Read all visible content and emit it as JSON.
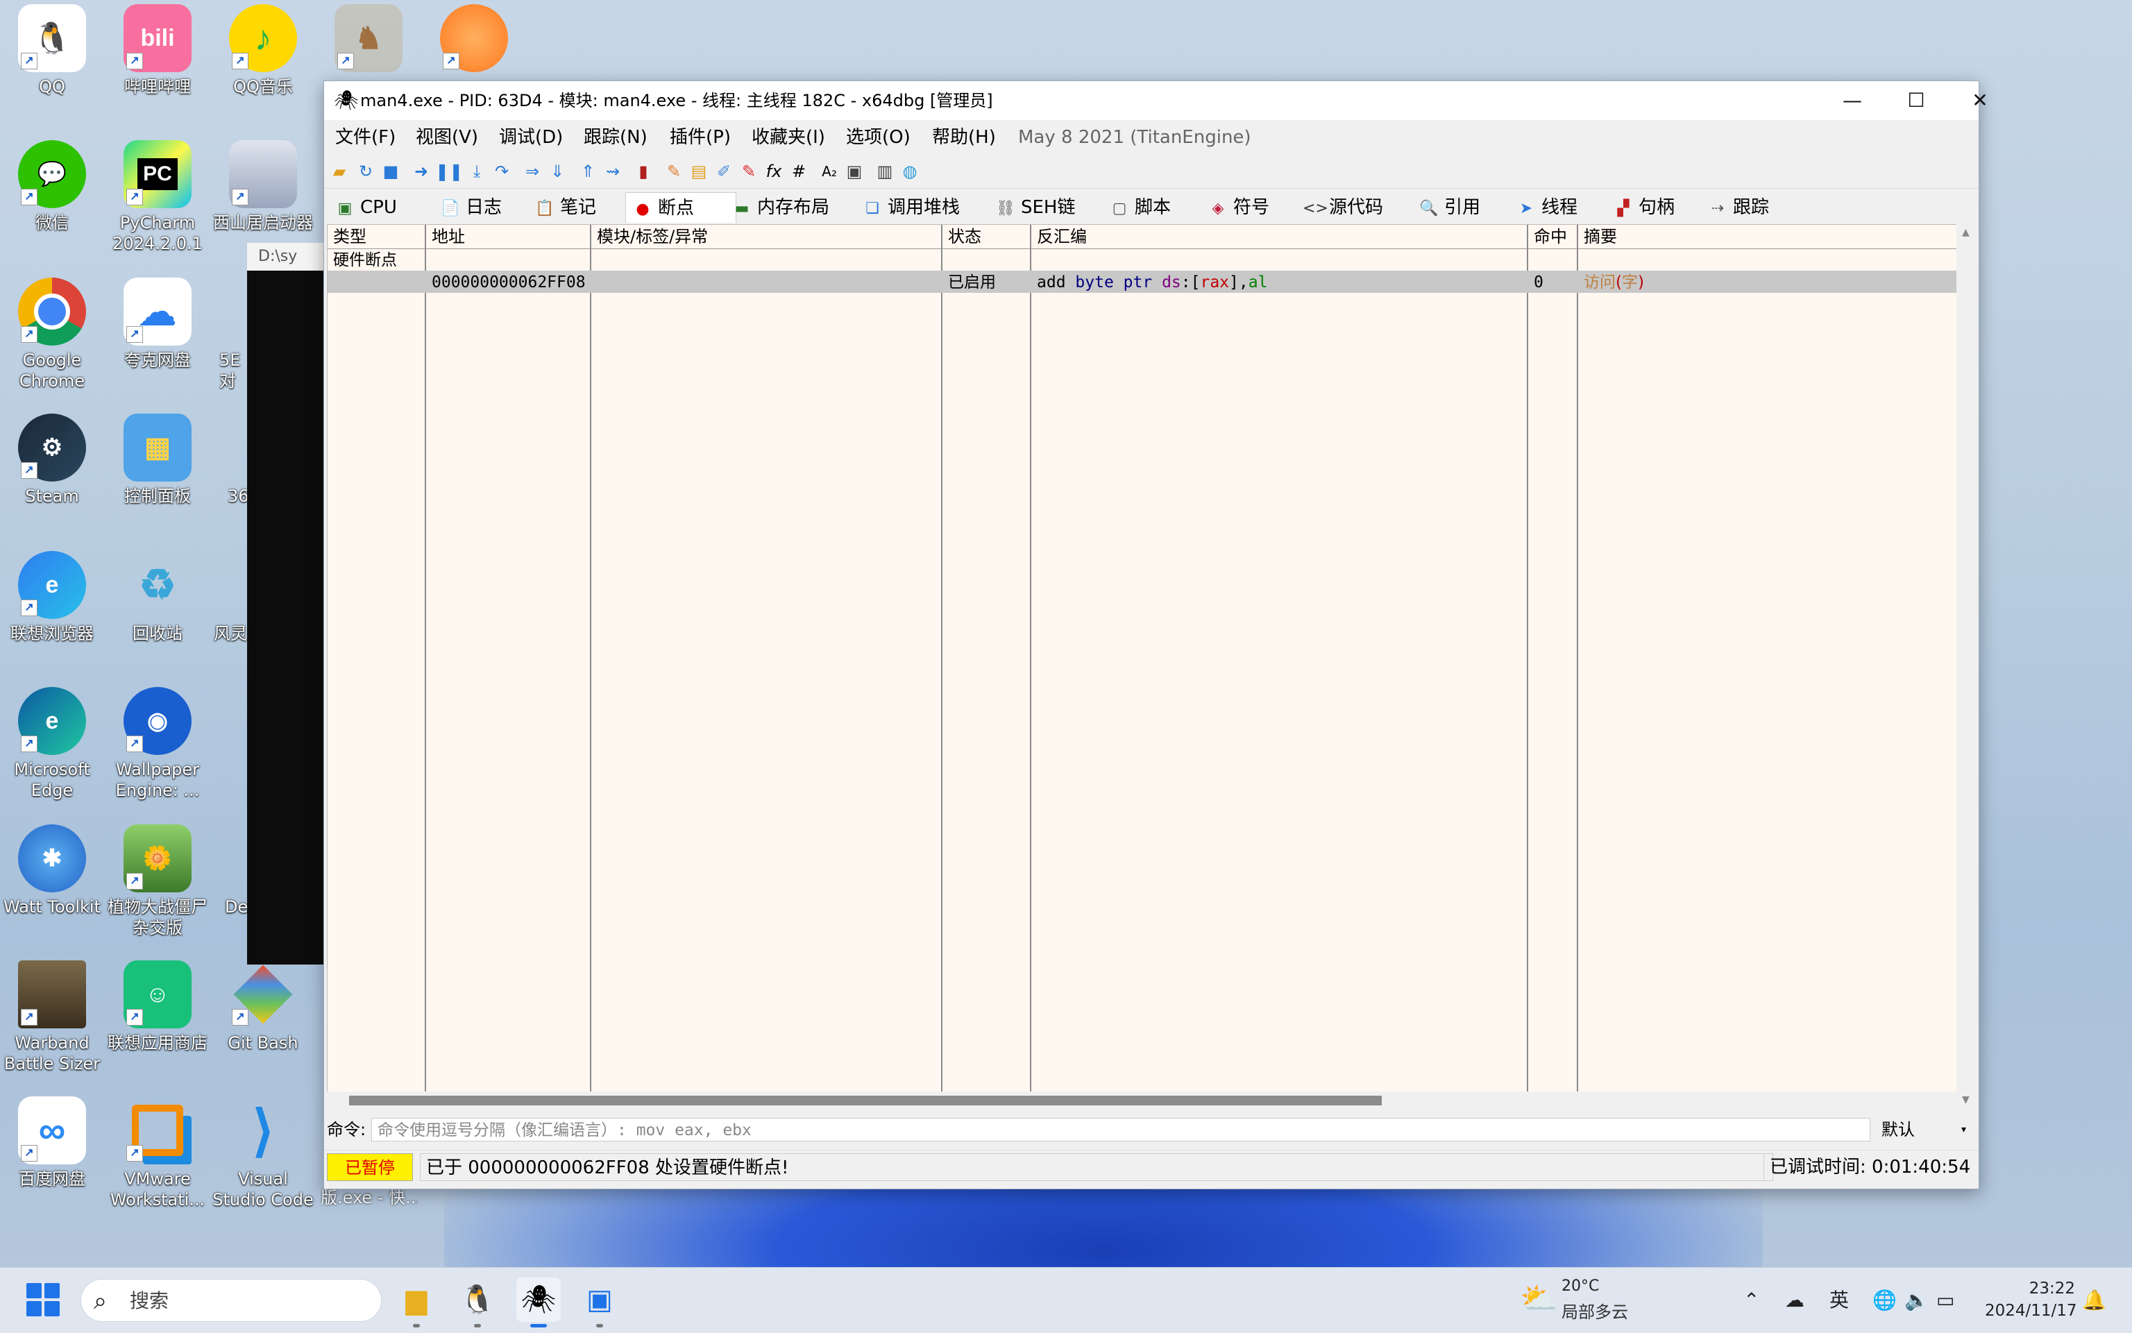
{
  "desktop": {
    "icons": [
      {
        "label": "QQ"
      },
      {
        "label": "哔哩哔哩"
      },
      {
        "label": "QQ音乐"
      },
      {
        "label": "微信"
      },
      {
        "label": "PyCharm 2024.2.0.1"
      },
      {
        "label": "西山居启动器 - 尘白禁区"
      },
      {
        "label": "Google Chrome"
      },
      {
        "label": "夸克网盘"
      },
      {
        "label": "5E对"
      },
      {
        "label": "Steam"
      },
      {
        "label": "控制面板"
      },
      {
        "label": "36"
      },
      {
        "label": "联想浏览器"
      },
      {
        "label": "回收站"
      },
      {
        "label": "风灵"
      },
      {
        "label": "Microsoft Edge"
      },
      {
        "label": "Wallpaper Engine: ..."
      },
      {
        "label": "Watt Toolkit"
      },
      {
        "label": "植物大战僵尸杂交版"
      },
      {
        "label": "De"
      },
      {
        "label": "Warband Battle Sizer"
      },
      {
        "label": "联想应用商店"
      },
      {
        "label": "Git Bash"
      },
      {
        "label": "百度网盘"
      },
      {
        "label": "VMware Workstati..."
      },
      {
        "label": "Visual Studio Code"
      }
    ],
    "console_title": "D:\\sy",
    "console_caption": "版.exe - 快..."
  },
  "window": {
    "title": "man4.exe - PID: 63D4 - 模块: man4.exe - 线程: 主线程 182C - x64dbg [管理员]",
    "menus": [
      "文件(F)",
      "视图(V)",
      "调试(D)",
      "跟踪(N)",
      "插件(P)",
      "收藏夹(I)",
      "选项(O)",
      "帮助(H)"
    ],
    "build_info": "May 8 2021 (TitanEngine)",
    "tabs": [
      {
        "label": "CPU",
        "icon": "cpu-icon"
      },
      {
        "label": "日志",
        "icon": "log-icon"
      },
      {
        "label": "笔记",
        "icon": "notes-icon"
      },
      {
        "label": "断点",
        "icon": "breakpoint-icon"
      },
      {
        "label": "内存布局",
        "icon": "memory-icon"
      },
      {
        "label": "调用堆栈",
        "icon": "callstack-icon"
      },
      {
        "label": "SEH链",
        "icon": "seh-icon"
      },
      {
        "label": "脚本",
        "icon": "script-icon"
      },
      {
        "label": "符号",
        "icon": "symbols-icon"
      },
      {
        "label": "源代码",
        "icon": "source-icon"
      },
      {
        "label": "引用",
        "icon": "references-icon"
      },
      {
        "label": "线程",
        "icon": "threads-icon"
      },
      {
        "label": "句柄",
        "icon": "handles-icon"
      },
      {
        "label": "跟踪",
        "icon": "trace-icon"
      }
    ],
    "active_tab": "断点",
    "table": {
      "columns": [
        "类型",
        "地址",
        "模块/标签/异常",
        "状态",
        "反汇编",
        "命中",
        "摘要"
      ],
      "group": "硬件断点",
      "rows": [
        {
          "type": "",
          "address": "000000000062FF08",
          "module": "",
          "state": "已启用",
          "disasm": {
            "op": "add",
            "size": "byte",
            "ptr": "ptr",
            "seg": "ds",
            "reg": "rax",
            "src": "al"
          },
          "hits": "0",
          "summary": {
            "access": "访问",
            "width": "字"
          }
        }
      ]
    },
    "command": {
      "label": "命令:",
      "placeholder": "命令使用逗号分隔（像汇编语言）: mov eax, ebx",
      "engine": "默认"
    },
    "status": {
      "state": "已暂停",
      "message": "已于 000000000062FF08 处设置硬件断点!",
      "debug_time_label": "已调试时间:",
      "debug_time": "0:01:40:54"
    }
  },
  "taskbar": {
    "search_placeholder": "搜索",
    "weather_temp": "20°C",
    "weather_desc": "局部多云",
    "ime": "英",
    "time": "23:22",
    "date": "2024/11/17"
  },
  "colors": {
    "table_bg": "#fff8f0",
    "selected_row": "#c8c8c8",
    "paused_bg": "#ffef00",
    "paused_fg": "#e00000",
    "disasm_keyword": "#000080",
    "disasm_register": "#008000",
    "disasm_segment": "#800080",
    "summary_access": "#c08040"
  }
}
